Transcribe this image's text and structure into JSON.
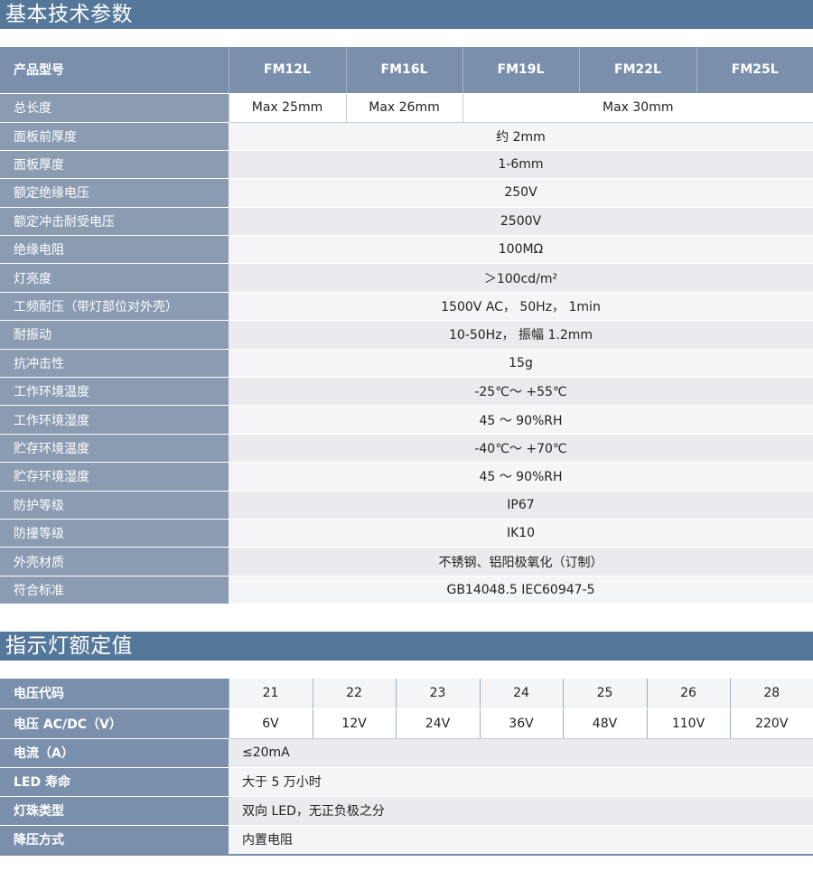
{
  "section1": {
    "title": "基本技术参数",
    "header": {
      "label": "产品型号",
      "models": [
        "FM12L",
        "FM16L",
        "FM19L",
        "FM22L",
        "FM25L"
      ]
    },
    "length": {
      "label": "总长度",
      "values": [
        "Max  25mm",
        "Max  26mm",
        "Max  30mm"
      ]
    },
    "rows": [
      {
        "label": "面板前厚度",
        "value": "约 2mm"
      },
      {
        "label": "面板厚度",
        "value": "1-6mm"
      },
      {
        "label": "额定绝缘电压",
        "value": "250V"
      },
      {
        "label": "额定冲击耐受电压",
        "value": "2500V"
      },
      {
        "label": "绝缘电阻",
        "value": "100MΩ"
      },
      {
        "label": "灯亮度",
        "value": "＞100cd/m²"
      },
      {
        "label": "工频耐压（带灯部位对外壳）",
        "value": "1500V  AC，   50Hz，   1min"
      },
      {
        "label": "耐振动",
        "value": "10-50Hz，      振幅 1.2mm"
      },
      {
        "label": "抗冲击性",
        "value": "15g"
      },
      {
        "label": "工作环境温度",
        "value": "-25℃～ +55℃"
      },
      {
        "label": "工作环境湿度",
        "value": "45 ～ 90%RH"
      },
      {
        "label": "贮存环境温度",
        "value": "-40℃～ +70℃"
      },
      {
        "label": "贮存环境湿度",
        "value": "45 ～ 90%RH"
      },
      {
        "label": "防护等级",
        "value": "IP67"
      },
      {
        "label": "防撞等级",
        "value": "IK10"
      },
      {
        "label": "外壳材质",
        "value": "不锈钢、铝阳极氧化（订制）"
      },
      {
        "label": "符合标准",
        "value": "GB14048.5       IEC60947-5"
      }
    ]
  },
  "section2": {
    "title": "指示灯额定值",
    "codes": {
      "label": "电压代码",
      "values": [
        "21",
        "22",
        "23",
        "24",
        "25",
        "26",
        "28"
      ]
    },
    "voltages": {
      "label": "电压 AC/DC（V）",
      "values": [
        "6V",
        "12V",
        "24V",
        "36V",
        "48V",
        "110V",
        "220V"
      ]
    },
    "rows": [
      {
        "label": "电流（A）",
        "value": "≤20mA"
      },
      {
        "label": "LED 寿命",
        "value": "大于 5 万小时"
      },
      {
        "label": "灯珠类型",
        "value": "双向 LED，无正负极之分"
      },
      {
        "label": "降压方式",
        "value": "内置电阻"
      }
    ]
  }
}
